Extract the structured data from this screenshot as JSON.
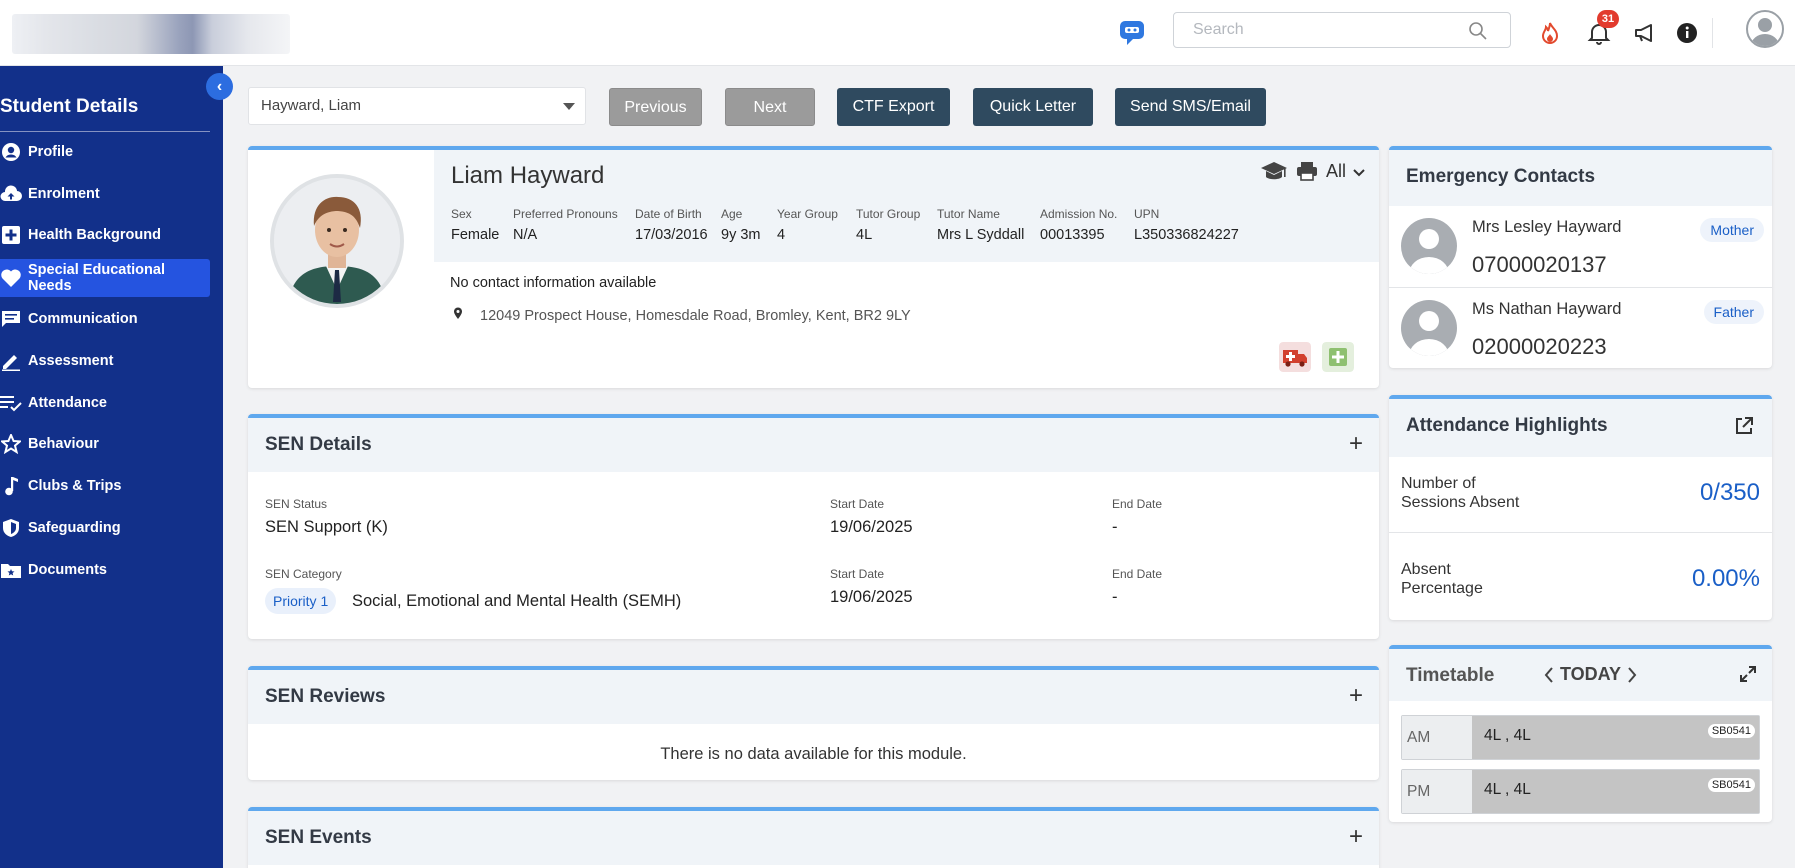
{
  "header": {
    "search_placeholder": "Search",
    "notification_count": "31"
  },
  "sidebar": {
    "title": "Student Details",
    "items": [
      {
        "label": "Profile",
        "icon": "person-circle-icon"
      },
      {
        "label": "Enrolment",
        "icon": "cloud-upload-icon"
      },
      {
        "label": "Health Background",
        "icon": "medical-plus-icon"
      },
      {
        "label": "Special Educational Needs",
        "icon": "heart-icon"
      },
      {
        "label": "Communication",
        "icon": "message-icon"
      },
      {
        "label": "Assessment",
        "icon": "pencil-icon"
      },
      {
        "label": "Attendance",
        "icon": "checklist-icon"
      },
      {
        "label": "Behaviour",
        "icon": "star-icon"
      },
      {
        "label": "Clubs & Trips",
        "icon": "music-note-icon"
      },
      {
        "label": "Safeguarding",
        "icon": "shield-icon"
      },
      {
        "label": "Documents",
        "icon": "folder-icon"
      }
    ],
    "active_item": "Special Educational Needs"
  },
  "actions": {
    "student_select": "Hayward, Liam",
    "previous": "Previous",
    "next": "Next",
    "ctf_export": "CTF Export",
    "quick_letter": "Quick Letter",
    "send_sms": "Send SMS/Email"
  },
  "profile": {
    "name": "Liam Hayward",
    "filter": "All",
    "fields": [
      {
        "label": "Sex",
        "value": "Female"
      },
      {
        "label": "Preferred Pronouns",
        "value": "N/A"
      },
      {
        "label": "Date of Birth",
        "value": "17/03/2016"
      },
      {
        "label": "Age",
        "value": "9y 3m"
      },
      {
        "label": "Year Group",
        "value": "4"
      },
      {
        "label": "Tutor Group",
        "value": "4L"
      },
      {
        "label": "Tutor Name",
        "value": "Mrs L Syddall"
      },
      {
        "label": "Admission No.",
        "value": "00013395"
      },
      {
        "label": "UPN",
        "value": "L350336824227"
      }
    ],
    "contact": "No contact information available",
    "address": "12049 Prospect House, Homesdale Road, Bromley, Kent, BR2 9LY"
  },
  "sen_details": {
    "title": "SEN Details",
    "status_label": "SEN Status",
    "status_value": "SEN Support (K)",
    "start_label": "Start Date",
    "start_value_1": "19/06/2025",
    "end_label": "End Date",
    "end_value_1": "-",
    "category_label": "SEN Category",
    "priority": "Priority 1",
    "category_value": "Social, Emotional and Mental Health (SEMH)",
    "start_value_2": "19/06/2025",
    "end_value_2": "-"
  },
  "sen_reviews": {
    "title": "SEN Reviews",
    "empty": "There is no data available for this module."
  },
  "sen_events": {
    "title": "SEN Events"
  },
  "emergency": {
    "title": "Emergency Contacts",
    "contacts": [
      {
        "name": "Mrs Lesley Hayward",
        "phone": "07000020137",
        "relation": "Mother"
      },
      {
        "name": "Ms Nathan Hayward",
        "phone": "02000020223",
        "relation": "Father"
      }
    ]
  },
  "attendance": {
    "title": "Attendance Highlights",
    "sessions_label_1": "Number of",
    "sessions_label_2": "Sessions Absent",
    "sessions_value": "0/350",
    "pct_label_1": "Absent",
    "pct_label_2": "Percentage",
    "pct_value": "0.00%"
  },
  "timetable": {
    "title": "Timetable",
    "today": "TODAY",
    "rows": [
      {
        "period": "AM",
        "class": "4L , 4L",
        "room": "SB0541"
      },
      {
        "period": "PM",
        "class": "4L , 4L",
        "room": "SB0541"
      }
    ]
  },
  "colors": {
    "sidebar": "#12308a",
    "active": "#2554e0",
    "accent": "#5fa8ee",
    "dark_button": "#2f4a5f"
  }
}
